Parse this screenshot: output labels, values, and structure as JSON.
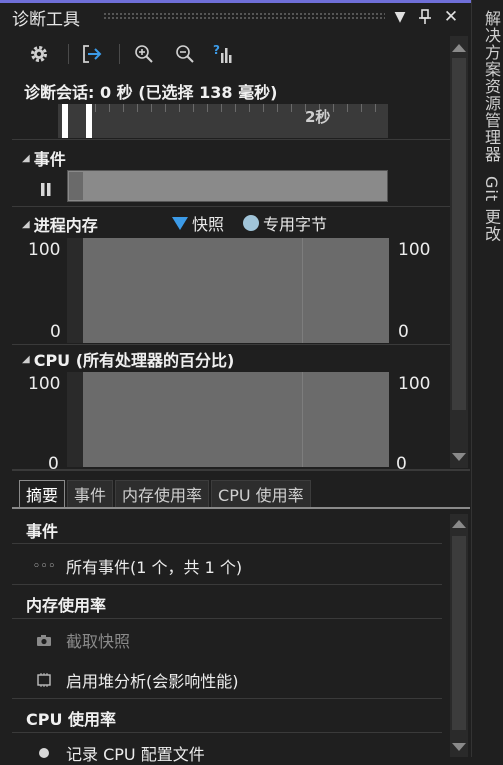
{
  "window": {
    "title": "诊断工具",
    "dropdown_glyph": "▼",
    "pin_glyph": "⊥",
    "close_glyph": "✕"
  },
  "toolbar": {
    "icons": [
      "gear-icon",
      "export-icon",
      "zoom-in-icon",
      "zoom-out-icon",
      "help-chart-icon"
    ]
  },
  "session": {
    "text": "诊断会话: 0 秒 (已选择 138 毫秒)"
  },
  "timeline": {
    "label": "2秒"
  },
  "events": {
    "title": "事件",
    "pause_glyph": "⏸"
  },
  "memory": {
    "title": "进程内存",
    "legend_snapshot": "快照",
    "legend_private": "专用字节",
    "y_max_left": "100",
    "y_min_left": "0",
    "y_max_right": "100",
    "y_min_right": "0",
    "colors": {
      "snapshot": "#3c9be8",
      "private_bytes": "#a0c4d8"
    }
  },
  "cpu": {
    "title": "CPU (所有处理器的百分比)",
    "y_max_left": "100",
    "y_min_left": "0",
    "y_max_right": "100",
    "y_min_right": "0"
  },
  "tabs": [
    {
      "label": "摘要",
      "active": true
    },
    {
      "label": "事件",
      "active": false
    },
    {
      "label": "内存使用率",
      "active": false
    },
    {
      "label": "CPU 使用率",
      "active": false
    }
  ],
  "summary": {
    "events_head": "事件",
    "all_events": "所有事件(1 个，共 1 个)",
    "memory_head": "内存使用率",
    "take_snapshot": "截取快照",
    "enable_heap": "启用堆分析(会影响性能)",
    "cpu_head": "CPU 使用率",
    "record_cpu": "记录 CPU 配置文件"
  },
  "side_rail": {
    "solution_explorer": "解决方案资源管理器",
    "git_changes": "Git 更改"
  }
}
